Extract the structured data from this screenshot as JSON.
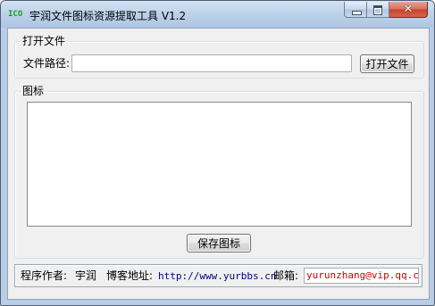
{
  "window": {
    "icon_text": "ICO",
    "title": "宇润文件图标资源提取工具 V1.2",
    "close_glyph": "✕"
  },
  "open_file_group": {
    "title": "打开文件",
    "path_label": "文件路径:",
    "path_value": "",
    "open_button": "打开文件"
  },
  "icon_group": {
    "title": "图标",
    "save_button": "保存图标"
  },
  "status": {
    "author_label": "程序作者:",
    "author_name": "宇润",
    "blog_label": "博客地址:",
    "blog_url": "http://www.yurbbs.cn",
    "email_label": "邮箱:",
    "email_value": "yurunzhang@vip.qq.com"
  },
  "colors": {
    "icon_text": "#1a9a1a",
    "url": "#000080",
    "email": "#d00000"
  }
}
